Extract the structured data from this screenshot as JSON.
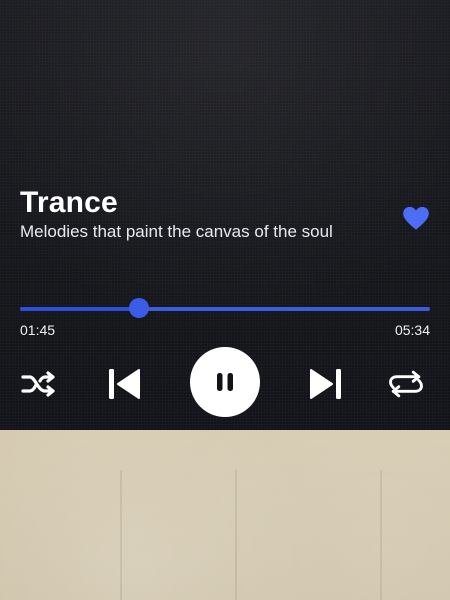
{
  "track": {
    "title": "Trance",
    "subtitle": "Melodies that paint the canvas of the soul",
    "favorite": true
  },
  "playback": {
    "elapsed": "01:45",
    "duration": "05:34",
    "progress_fraction": 0.29,
    "state": "playing"
  },
  "controls": {
    "icons": [
      "shuffle-icon",
      "previous-icon",
      "pause-icon",
      "next-icon",
      "repeat-icon"
    ]
  },
  "colors": {
    "accent": "#3b5ce6",
    "heart": "#4c6ef5"
  }
}
